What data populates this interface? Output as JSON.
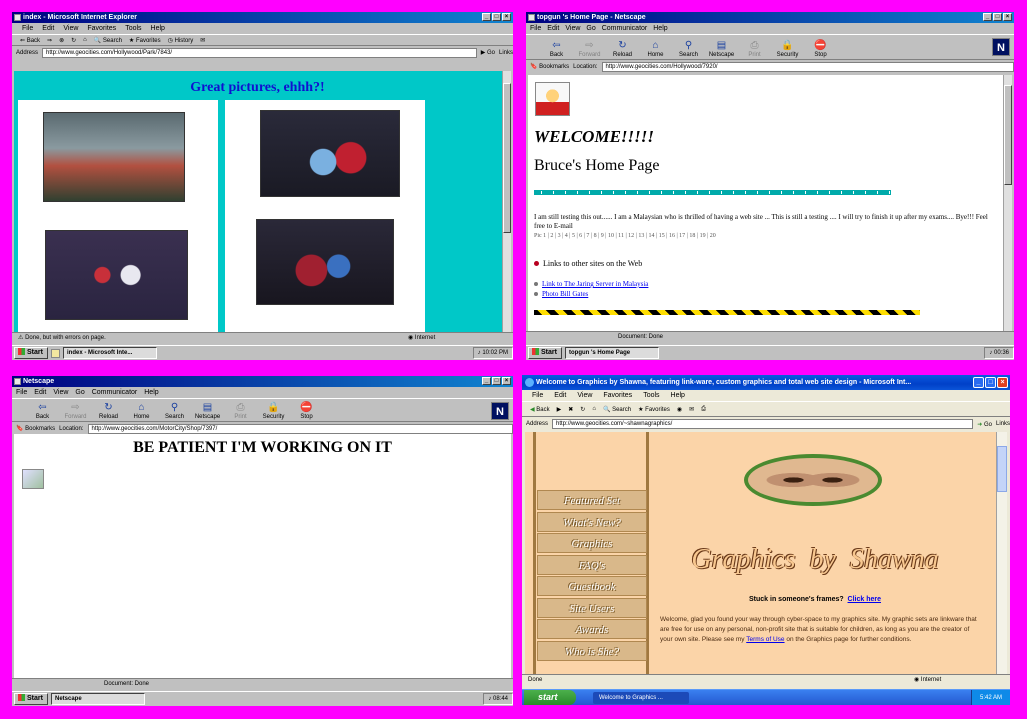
{
  "q1": {
    "title": "index - Microsoft Internet Explorer",
    "menu": [
      "File",
      "Edit",
      "View",
      "Favorites",
      "Tools",
      "Help"
    ],
    "toolbar": [
      "Back",
      "Stop",
      "Refresh",
      "Home",
      "Search",
      "Favorites",
      "History"
    ],
    "address_label": "Address",
    "address": "http://www.geocities.com/Hollywood/Park/7843/",
    "go": "Go",
    "links": "Links",
    "heading": "Great pictures, ehhh?!",
    "status": "Done, but with errors on page.",
    "zone": "Internet",
    "task": "index - Microsoft Inte...",
    "clock": "10:02 PM",
    "start": "Start",
    "accent": "#00c8c8"
  },
  "q2": {
    "title": "topgun 's Home Page - Netscape",
    "menu": [
      "File",
      "Edit",
      "View",
      "Go",
      "Communicator",
      "Help"
    ],
    "toolbar": [
      "Back",
      "Forward",
      "Reload",
      "Home",
      "Search",
      "Netscape",
      "Print",
      "Security",
      "Stop"
    ],
    "bookmarks": "Bookmarks",
    "location_label": "Location:",
    "location": "http://www.geocities.com/Hollywood/7920/",
    "welcome": "WELCOME!!!!!",
    "home": "Bruce's Home Page",
    "para": "I am still testing this out...... I am a Malaysian who is thrilled of having a web site ...  This is still a testing .... I will try to finish it up after my exams.... Bye!!! Feel free to E-mail",
    "numbers": "Pic 1 | 2 | 3 | 4 | 5 | 6 | 7 | 8 | 9 | 10 | 11 | 12 | 13 | 14 | 15 | 16 | 17 | 18 | 19 | 20",
    "links_heading": "Links to other sites on the Web",
    "link1": "Link to The Jaring Server in Malaysia",
    "link2": "Photo Bill Gates",
    "status": "Document: Done",
    "task": "topgun 's Home Page",
    "clock": "00:36",
    "start": "Start"
  },
  "q3": {
    "title": "Netscape",
    "menu": [
      "File",
      "Edit",
      "View",
      "Go",
      "Communicator",
      "Help"
    ],
    "toolbar": [
      "Back",
      "Forward",
      "Reload",
      "Home",
      "Search",
      "Netscape",
      "Print",
      "Security",
      "Stop"
    ],
    "bookmarks": "Bookmarks",
    "location_label": "Location:",
    "location": "http://www.geocities.com/MotorCity/Shop/7397/",
    "heading": "BE PATIENT I'M WORKING ON IT",
    "status": "Document: Done",
    "task": "Netscape",
    "clock": "08:44",
    "start": "Start"
  },
  "q4": {
    "title": "Welcome to Graphics by Shawna, featuring link-ware, custom graphics and total web site design - Microsoft Int...",
    "menu": [
      "File",
      "Edit",
      "View",
      "Favorites",
      "Tools",
      "Help"
    ],
    "toolbar": [
      "Back",
      "Search",
      "Favorites"
    ],
    "address_label": "Address",
    "address": "http://www.geocities.com/~shawnagraphics/",
    "go": "Go",
    "links": "Links",
    "nav": [
      "Featured Set",
      "What's New?",
      "Graphics",
      "FAQ's",
      "Guestbook",
      "Site Users",
      "Awards",
      "Who is She?"
    ],
    "site_title": "Graphics  by  Shawna",
    "stuck": "Stuck in someone's frames?",
    "click_here": "Click here",
    "body": "Welcome, glad you found your way through cyber-space to my graphics site. My graphic sets are linkware that are free for use on any personal, non-profit site that is suitable for children, as long as you are the creator of your own site. Please see my",
    "terms": "Terms of Use",
    "body2": "on the Graphics page for further conditions.",
    "status": "Done",
    "zone": "Internet",
    "task": "Welcome to Graphics ...",
    "clock": "5:42 AM",
    "start": "start",
    "bg": "#fbd4a8"
  }
}
